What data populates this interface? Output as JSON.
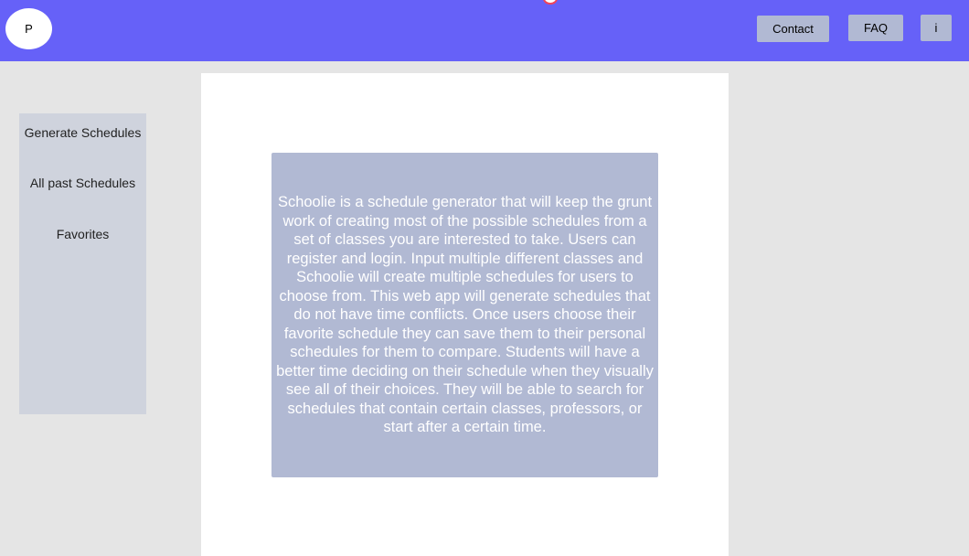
{
  "header": {
    "logo_label": "P",
    "nav": {
      "contact_label": "Contact",
      "faq_label": "FAQ",
      "info_label": "i"
    }
  },
  "sidebar": {
    "items": [
      {
        "label": "Generate Schedules"
      },
      {
        "label": "All past Schedules"
      },
      {
        "label": "Favorites"
      }
    ]
  },
  "main": {
    "description": "Schoolie is a schedule generator that will keep the grunt work of creating most of the possible schedules from a set of classes you are interested to take. Users can register and login. Input multiple different classes and Schoolie will create multiple schedules for users to choose from. This web app will generate schedules that do not have time conflicts. Once users choose their favorite schedule they can save them to their personal schedules for them to compare. Students will have a better time deciding on their schedule when they visually see all of their choices. They will be able to search for schedules that contain certain classes, professors, or start after a certain time."
  },
  "colors": {
    "header_bg": "#6661f8",
    "button_bg": "#b1b9d3",
    "sidebar_bg": "#cfd3dd",
    "page_bg": "#e5e5e5",
    "content_bg": "#ffffff"
  }
}
